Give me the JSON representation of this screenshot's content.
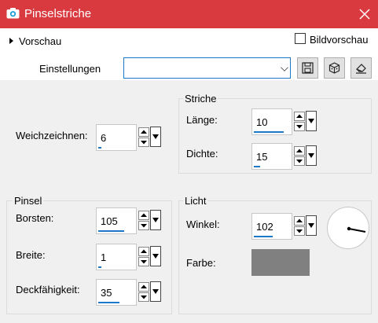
{
  "window": {
    "title": "Pinselstriche",
    "close_icon": "close-icon",
    "app_icon": "camera-icon"
  },
  "preview": {
    "label": "Vorschau",
    "expanded": false
  },
  "big_preview": {
    "label": "Bildvorschau",
    "checked": false
  },
  "settings": {
    "label": "Einstellungen",
    "value": "",
    "buttons": [
      "save-icon",
      "cube-icon",
      "eraser-icon"
    ]
  },
  "softness": {
    "label": "Weichzeichnen:",
    "value": "6"
  },
  "strokes": {
    "title": "Striche",
    "length": {
      "label": "Länge:",
      "value": "10"
    },
    "density": {
      "label": "Dichte:",
      "value": "15"
    }
  },
  "brush": {
    "title": "Pinsel",
    "bristles": {
      "label": "Borsten:",
      "value": "105"
    },
    "width": {
      "label": "Breite:",
      "value": "1"
    },
    "opacity": {
      "label": "Deckfähigkeit:",
      "value": "35"
    }
  },
  "light": {
    "title": "Licht",
    "angle": {
      "label": "Winkel:",
      "value": "102"
    },
    "color": {
      "label": "Farbe:",
      "value": "#808080"
    }
  },
  "colors": {
    "titlebar": "#d93a3f",
    "accent": "#1e78c8",
    "background": "#f0f0f0",
    "swatch": "#808080"
  }
}
